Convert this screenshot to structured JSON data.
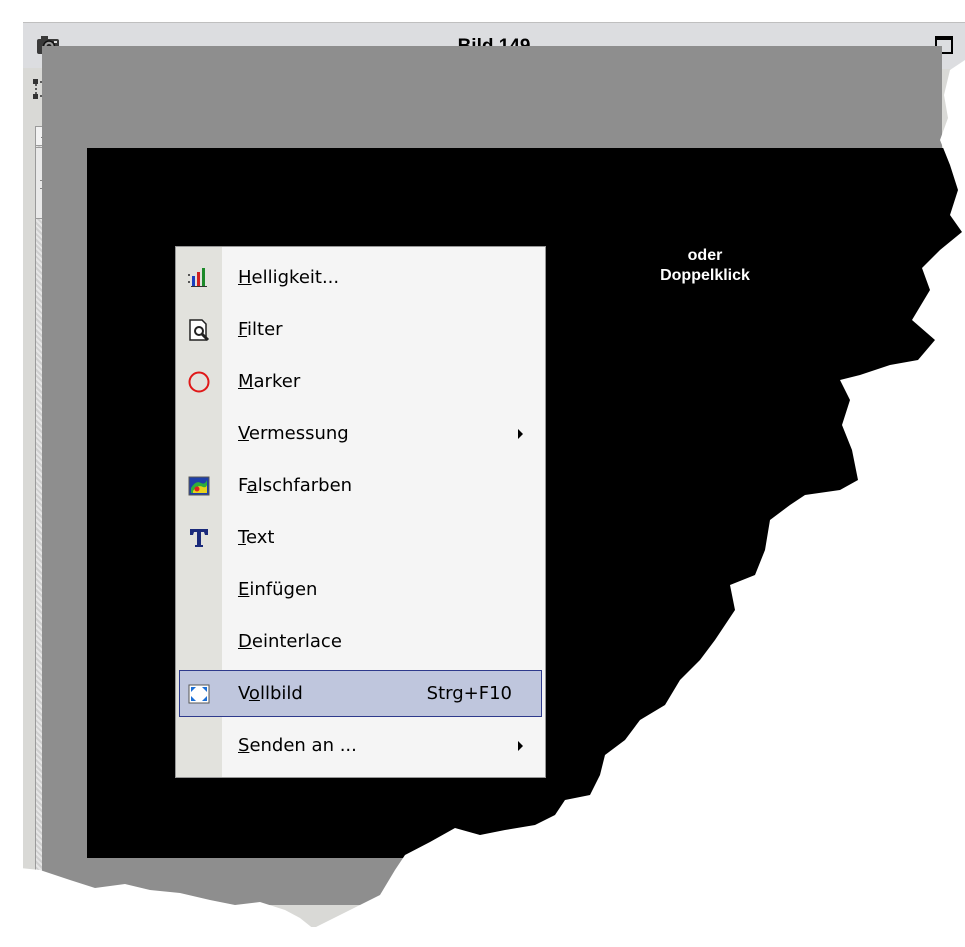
{
  "window": {
    "title": "Bild 149",
    "accent_color": "#2e3a8c"
  },
  "canvas": {
    "hint_line1": "oder",
    "hint_line2": "Doppelklick"
  },
  "context_menu": {
    "items": [
      {
        "label": "Helligkeit...",
        "mnemonic": "H",
        "icon": "brightness-chart-icon"
      },
      {
        "label": "Filter",
        "mnemonic": "F",
        "icon": "filter-magnifier-icon"
      },
      {
        "label": "Marker",
        "mnemonic": "M",
        "icon": "circle-marker-icon"
      },
      {
        "label": "Vermessung",
        "mnemonic": "V",
        "icon": "",
        "submenu": true
      },
      {
        "label": "Falschfarben",
        "mnemonic": "a",
        "icon": "false-color-icon"
      },
      {
        "label": "Text",
        "mnemonic": "T",
        "icon": "text-tool-icon"
      },
      {
        "label": "Einfügen",
        "mnemonic": "E",
        "icon": ""
      },
      {
        "label": "Deinterlace",
        "mnemonic": "D",
        "icon": ""
      },
      {
        "label": "Vollbild",
        "mnemonic": "o",
        "shortcut": "Strg+F10",
        "icon": "fullscreen-icon",
        "highlighted": true
      },
      {
        "label": "Senden an ...",
        "mnemonic": "S",
        "icon": "",
        "submenu": true
      }
    ]
  }
}
